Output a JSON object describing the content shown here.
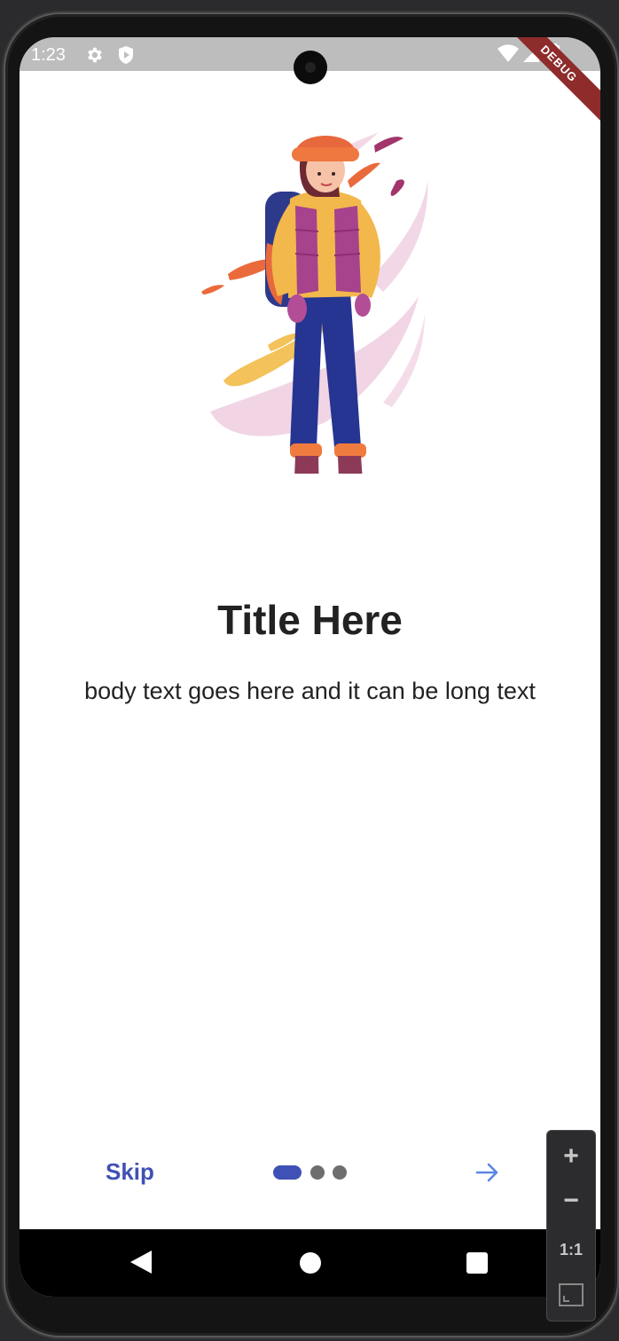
{
  "status_bar": {
    "time": "1:23",
    "left_icons": [
      "settings-gear-icon",
      "shield-play-icon"
    ],
    "right_icons": [
      "wifi-icon",
      "cell-signal-icon",
      "battery-icon"
    ]
  },
  "debug_banner": "DEBUG",
  "onboarding": {
    "title": "Title Here",
    "body": "body text goes here and it can be long text",
    "skip_label": "Skip",
    "page_count": 3,
    "current_page": 1,
    "next_icon": "arrow-right-icon"
  },
  "nav_bar": [
    "back-icon",
    "home-icon",
    "recents-icon"
  ],
  "zoom_controls": {
    "zoom_in": "+",
    "zoom_out": "−",
    "actual_size": "1:1",
    "fit_icon": "fit-screen-icon"
  },
  "colors": {
    "accent": "#3f51b5",
    "arrow": "#5b86e5",
    "inactive_dot": "#6e6e6e",
    "status_bar": "#bdbdbd",
    "nav_bar": "#000000"
  }
}
